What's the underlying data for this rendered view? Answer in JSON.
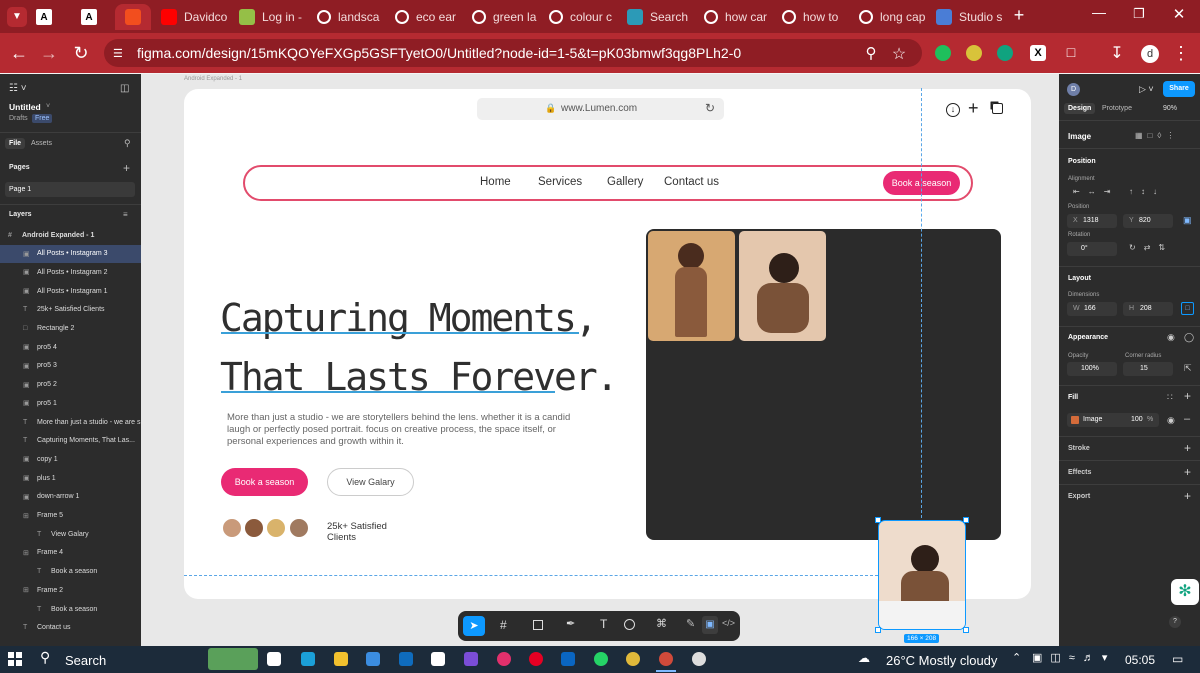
{
  "browser": {
    "tabs": [
      {
        "label": "",
        "icon": "A"
      },
      {
        "label": "",
        "icon": "A"
      },
      {
        "label": "",
        "icon": "figma"
      },
      {
        "label": "Davidco",
        "icon": "yt"
      },
      {
        "label": "Log in -",
        "icon": "shopify"
      },
      {
        "label": "landsca",
        "icon": "google"
      },
      {
        "label": "eco ear",
        "icon": "google"
      },
      {
        "label": "green la",
        "icon": "google"
      },
      {
        "label": "colour c",
        "icon": "google"
      },
      {
        "label": "Search",
        "icon": "v"
      },
      {
        "label": "how car",
        "icon": "google"
      },
      {
        "label": "how to",
        "icon": "google"
      },
      {
        "label": "long cap",
        "icon": "google"
      },
      {
        "label": "Studio s",
        "icon": "doc"
      }
    ],
    "url": "figma.com/design/15mKQOYeFXGp5GSFTyetO0/Untitled?node-id=1-5&t=pK03bmwf3qg8PLh2-0",
    "profile": "d"
  },
  "figma": {
    "file_title": "Untitled",
    "drafts": "Drafts",
    "plan": "Free",
    "tab_file": "File",
    "tab_assets": "Assets",
    "pages_label": "Pages",
    "page_name": "Page 1",
    "layers_label": "Layers",
    "layers": [
      {
        "name": "Android Expanded - 1",
        "icon": "#",
        "selected": false,
        "indent": 0
      },
      {
        "name": "All Posts • Instagram 3",
        "icon": "▣",
        "selected": true,
        "indent": 1
      },
      {
        "name": "All Posts • Instagram 2",
        "icon": "▣",
        "selected": false,
        "indent": 1
      },
      {
        "name": "All Posts • Instagram 1",
        "icon": "▣",
        "selected": false,
        "indent": 1
      },
      {
        "name": "25k+ Satisfied Clients",
        "icon": "T",
        "selected": false,
        "indent": 1
      },
      {
        "name": "Rectangle 2",
        "icon": "□",
        "selected": false,
        "indent": 1
      },
      {
        "name": "pro5 4",
        "icon": "▣",
        "selected": false,
        "indent": 1
      },
      {
        "name": "pro5 3",
        "icon": "▣",
        "selected": false,
        "indent": 1
      },
      {
        "name": "pro5 2",
        "icon": "▣",
        "selected": false,
        "indent": 1
      },
      {
        "name": "pro5 1",
        "icon": "▣",
        "selected": false,
        "indent": 1
      },
      {
        "name": "More than just a studio - we are s",
        "icon": "T",
        "selected": false,
        "indent": 1
      },
      {
        "name": "Capturing Moments, That Las...",
        "icon": "T",
        "selected": false,
        "indent": 1
      },
      {
        "name": "copy 1",
        "icon": "▣",
        "selected": false,
        "indent": 1
      },
      {
        "name": "plus 1",
        "icon": "▣",
        "selected": false,
        "indent": 1
      },
      {
        "name": "down-arrow 1",
        "icon": "▣",
        "selected": false,
        "indent": 1
      },
      {
        "name": "Frame 5",
        "icon": "⊞",
        "selected": false,
        "indent": 1
      },
      {
        "name": "View Galary",
        "icon": "T",
        "selected": false,
        "indent": 2
      },
      {
        "name": "Frame 4",
        "icon": "⊞",
        "selected": false,
        "indent": 1
      },
      {
        "name": "Book a season",
        "icon": "T",
        "selected": false,
        "indent": 2
      },
      {
        "name": "Frame 2",
        "icon": "⊞",
        "selected": false,
        "indent": 1
      },
      {
        "name": "Book a season",
        "icon": "T",
        "selected": false,
        "indent": 2
      },
      {
        "name": "Contact us",
        "icon": "T",
        "selected": false,
        "indent": 1
      }
    ],
    "frame_label": "Android Expanded - 1",
    "selection_size": "166 × 208",
    "right": {
      "avatar": "D",
      "share": "Share",
      "tab_design": "Design",
      "tab_prototype": "Prototype",
      "zoom": "90%",
      "section_image": "Image",
      "position": "Position",
      "alignment": "Alignment",
      "position_sub": "Position",
      "x_label": "X",
      "x": "1318",
      "y_label": "Y",
      "y": "820",
      "rotation": "Rotation",
      "rotation_value": "0°",
      "layout": "Layout",
      "dimensions": "Dimensions",
      "w_label": "W",
      "w": "166",
      "h_label": "H",
      "h": "208",
      "appearance": "Appearance",
      "opacity_label": "Opacity",
      "opacity": "100%",
      "radius_label": "Corner radius",
      "radius": "15",
      "fill": "Fill",
      "fill_type": "Image",
      "fill_opacity": "100",
      "fill_pct": "%",
      "stroke": "Stroke",
      "effects": "Effects",
      "export": "Export"
    }
  },
  "design": {
    "browser_url": "www.Lumen.com",
    "nav": [
      "Home",
      "Services",
      "Gallery",
      "Contact us"
    ],
    "nav_cta": "Book a season",
    "headline_1": "Capturing Moments,",
    "headline_2": "That Lasts Forever.",
    "paragraph": "More than just a studio  - we are storytellers behind the lens. whether it is a candid laugh or perfectly posed portrait. focus on creative process, the space itself, or personal experiences and growth within it.",
    "btn_primary": "Book a season",
    "btn_secondary": "View Galary",
    "clients_line1": "25k+ Satisfied",
    "clients_line2": "Clients"
  },
  "taskbar": {
    "search": "Search",
    "weather": "26°C  Mostly cloudy",
    "time": "05:05"
  },
  "colors": {
    "browser_accent": "#b52a31",
    "brand_pink": "#e92a74",
    "figma_blue": "#0d99ff"
  }
}
